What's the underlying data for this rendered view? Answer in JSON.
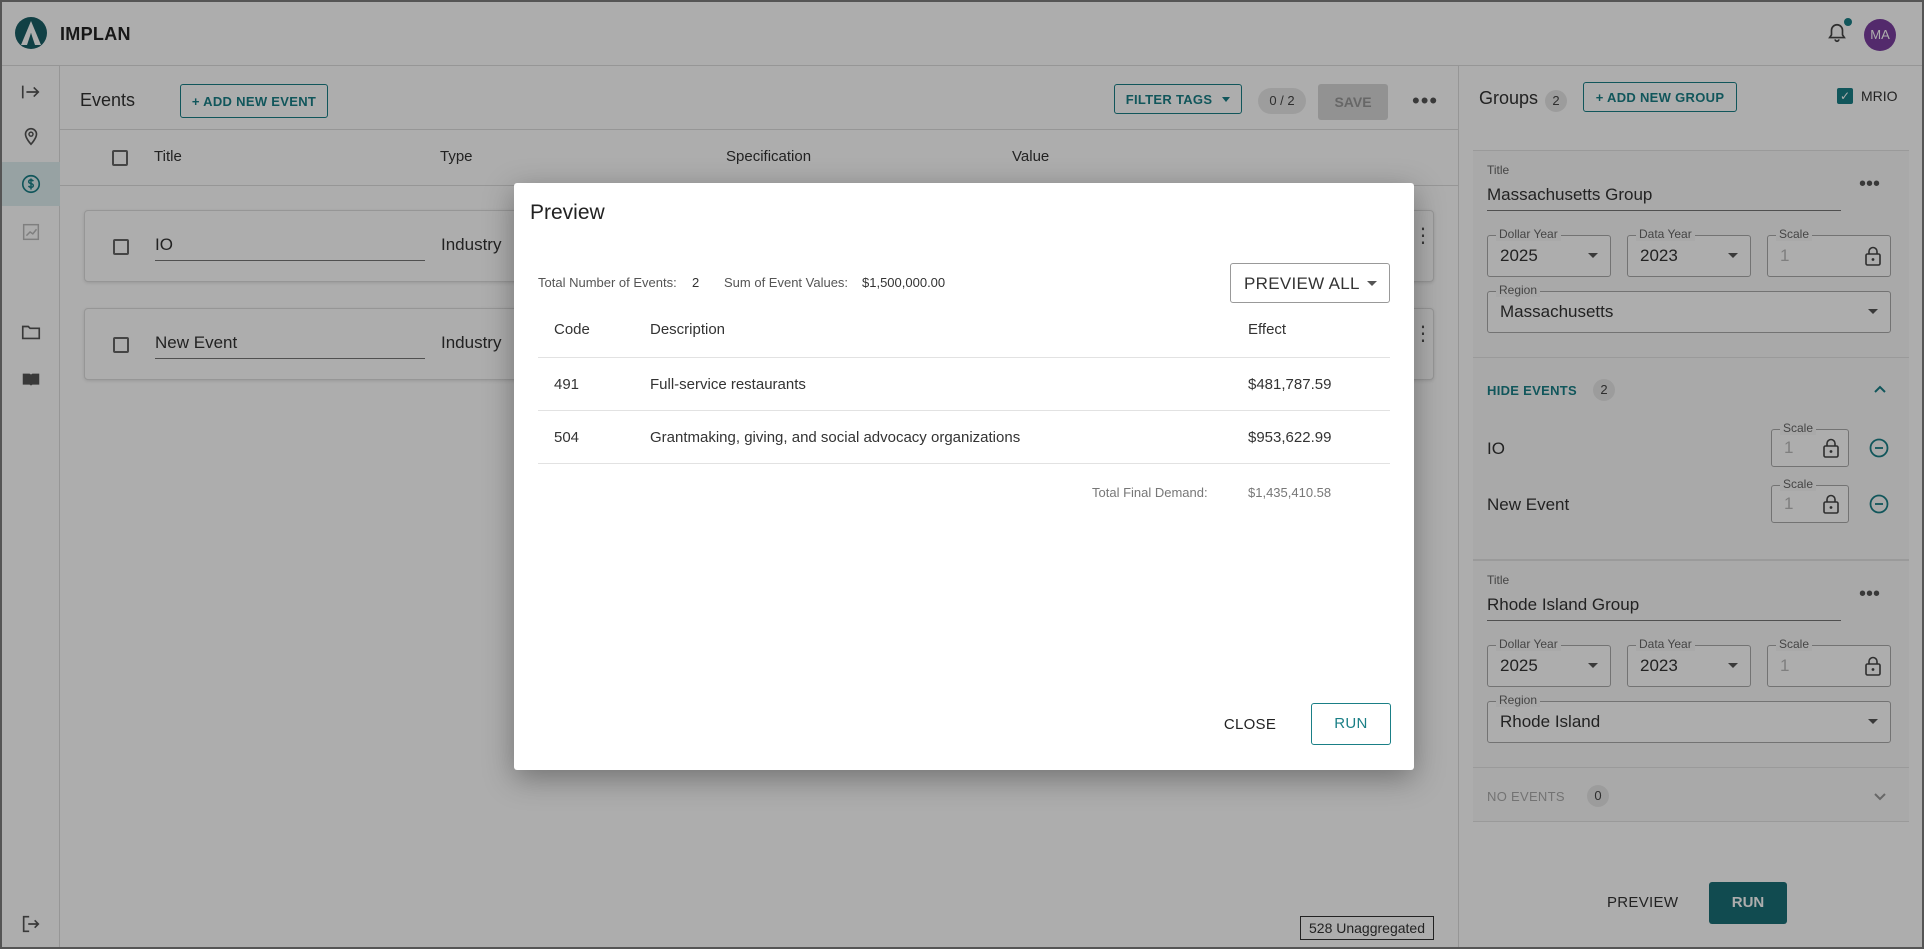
{
  "app": {
    "brand": "IMPLAN",
    "avatar_initials": "MA",
    "accent_color": "#1a7f86"
  },
  "nav": {
    "items": [
      {
        "name": "expand-icon"
      },
      {
        "name": "location-icon"
      },
      {
        "name": "dollar-icon",
        "active": true
      },
      {
        "name": "chart-icon"
      },
      {
        "name": "folder-icon"
      },
      {
        "name": "book-icon"
      }
    ],
    "logout_icon": "logout-icon"
  },
  "events": {
    "title": "Events",
    "count": "2",
    "add_label": "+ ADD NEW EVENT",
    "filter_label": "FILTER TAGS",
    "counter": "0 / 2",
    "save_label": "SAVE",
    "columns": [
      "Title",
      "Type",
      "Specification",
      "Value"
    ],
    "rows": [
      {
        "title": "IO",
        "type": "Industry"
      },
      {
        "title": "New Event",
        "type": "Industry"
      }
    ],
    "unaggregated": "528 Unaggregated"
  },
  "groups": {
    "title": "Groups",
    "count": "2",
    "add_label": "+ ADD NEW GROUP",
    "mrio_label": "MRIO",
    "list": [
      {
        "title_label": "Title",
        "title": "Massachusetts Group",
        "dollar_year_label": "Dollar Year",
        "dollar_year": "2025",
        "data_year_label": "Data Year",
        "data_year": "2023",
        "scale_label": "Scale",
        "scale": "1",
        "region_label": "Region",
        "region": "Massachusetts",
        "events_toggle": "HIDE EVENTS",
        "events_count": "2",
        "events": [
          {
            "name": "IO",
            "scale_label": "Scale",
            "scale": "1"
          },
          {
            "name": "New Event",
            "scale_label": "Scale",
            "scale": "1"
          }
        ]
      },
      {
        "title_label": "Title",
        "title": "Rhode Island Group",
        "dollar_year_label": "Dollar Year",
        "dollar_year": "2025",
        "data_year_label": "Data Year",
        "data_year": "2023",
        "scale_label": "Scale",
        "scale": "1",
        "region_label": "Region",
        "region": "Rhode Island",
        "events_toggle": "NO EVENTS",
        "events_count": "0"
      }
    ],
    "preview_label": "PREVIEW",
    "run_label": "RUN"
  },
  "modal": {
    "title": "Preview",
    "total_events_label": "Total Number of Events:",
    "total_events": "2",
    "sum_label": "Sum of Event Values:",
    "sum_value": "$1,500,000.00",
    "preview_select": "PREVIEW ALL",
    "columns": [
      "Code",
      "Description",
      "Effect"
    ],
    "rows": [
      {
        "code": "491",
        "description": "Full-service restaurants",
        "effect": "$481,787.59"
      },
      {
        "code": "504",
        "description": "Grantmaking, giving, and social advocacy organizations",
        "effect": "$953,622.99"
      }
    ],
    "total_label": "Total Final Demand:",
    "total_value": "$1,435,410.58",
    "close_label": "CLOSE",
    "run_label": "RUN"
  }
}
